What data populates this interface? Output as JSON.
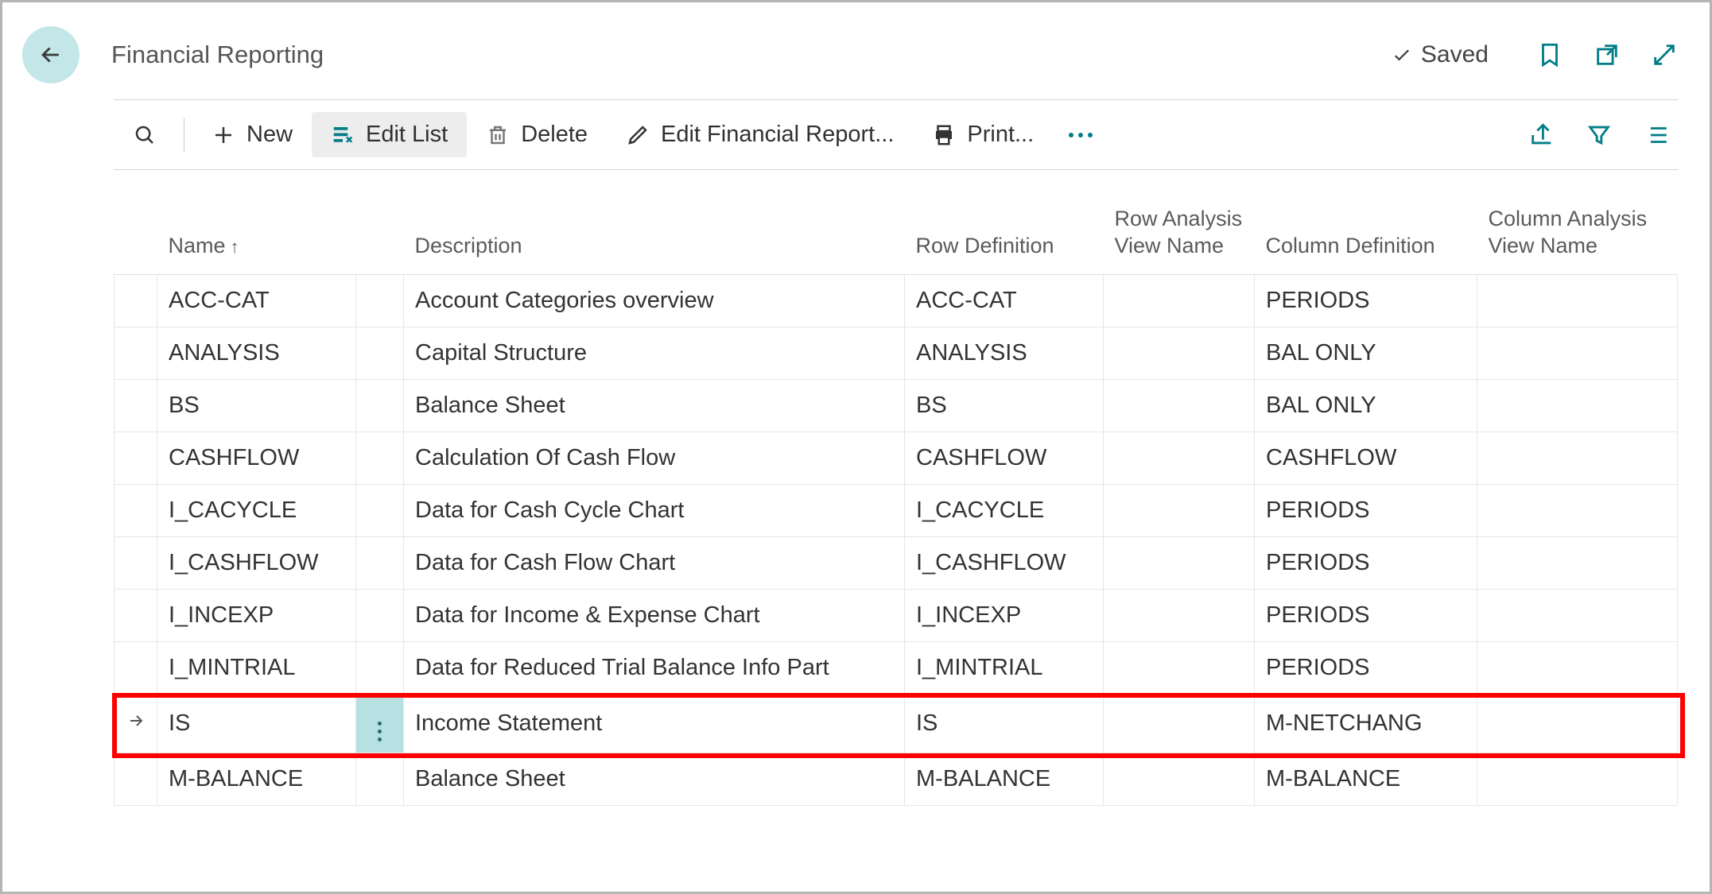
{
  "header": {
    "title": "Financial Reporting",
    "saved_label": "Saved"
  },
  "toolbar": {
    "new_label": "New",
    "edit_list_label": "Edit List",
    "delete_label": "Delete",
    "edit_report_label": "Edit Financial Report...",
    "print_label": "Print..."
  },
  "columns": {
    "name": "Name",
    "description": "Description",
    "row_definition": "Row Definition",
    "row_analysis": "Row Analysis View Name",
    "column_definition": "Column Definition",
    "column_analysis": "Column Analysis View Name"
  },
  "sort_indicator": "↑",
  "rows": [
    {
      "name": "ACC-CAT",
      "description": "Account Categories overview",
      "row_def": "ACC-CAT",
      "row_an": "",
      "col_def": "PERIODS",
      "col_an": "",
      "selected": false
    },
    {
      "name": "ANALYSIS",
      "description": "Capital Structure",
      "row_def": "ANALYSIS",
      "row_an": "",
      "col_def": "BAL ONLY",
      "col_an": "",
      "selected": false
    },
    {
      "name": "BS",
      "description": "Balance Sheet",
      "row_def": "BS",
      "row_an": "",
      "col_def": "BAL ONLY",
      "col_an": "",
      "selected": false
    },
    {
      "name": "CASHFLOW",
      "description": "Calculation Of Cash Flow",
      "row_def": "CASHFLOW",
      "row_an": "",
      "col_def": "CASHFLOW",
      "col_an": "",
      "selected": false
    },
    {
      "name": "I_CACYCLE",
      "description": "Data for Cash Cycle Chart",
      "row_def": "I_CACYCLE",
      "row_an": "",
      "col_def": "PERIODS",
      "col_an": "",
      "selected": false
    },
    {
      "name": "I_CASHFLOW",
      "description": "Data for Cash Flow Chart",
      "row_def": "I_CASHFLOW",
      "row_an": "",
      "col_def": "PERIODS",
      "col_an": "",
      "selected": false
    },
    {
      "name": "I_INCEXP",
      "description": "Data for Income & Expense Chart",
      "row_def": "I_INCEXP",
      "row_an": "",
      "col_def": "PERIODS",
      "col_an": "",
      "selected": false
    },
    {
      "name": "I_MINTRIAL",
      "description": "Data for Reduced Trial Balance Info Part",
      "row_def": "I_MINTRIAL",
      "row_an": "",
      "col_def": "PERIODS",
      "col_an": "",
      "selected": false
    },
    {
      "name": "IS",
      "description": "Income Statement",
      "row_def": "IS",
      "row_an": "",
      "col_def": "M-NETCHANG",
      "col_an": "",
      "selected": true
    },
    {
      "name": "M-BALANCE",
      "description": "Balance Sheet",
      "row_def": "M-BALANCE",
      "row_an": "",
      "col_def": "M-BALANCE",
      "col_an": "",
      "selected": false
    }
  ]
}
